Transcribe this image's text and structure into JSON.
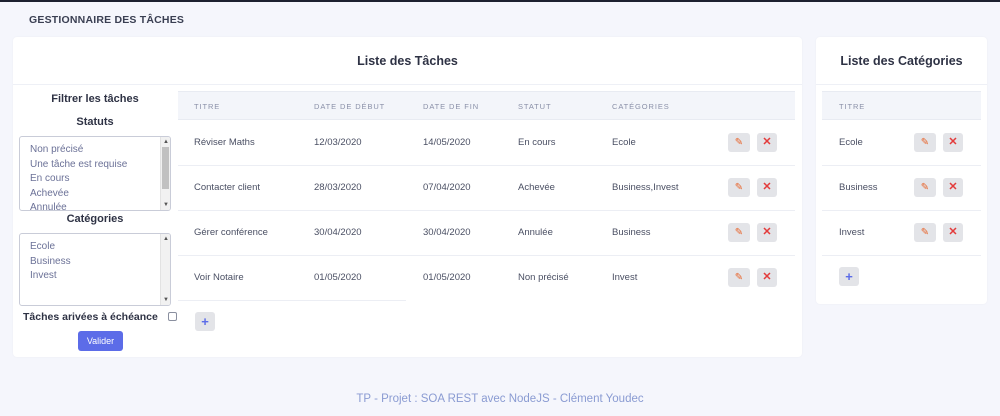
{
  "app": {
    "title": "GESTIONNAIRE DES TÂCHES"
  },
  "tasks": {
    "title": "Liste des Tâches",
    "columns": [
      "TITRE",
      "DATE DE DÉBUT",
      "DATE DE FIN",
      "STATUT",
      "CATÉGORIES"
    ],
    "rows": [
      [
        "Réviser Maths",
        "12/03/2020",
        "14/05/2020",
        "En cours",
        "Ecole"
      ],
      [
        "Contacter client",
        "28/03/2020",
        "07/04/2020",
        "Achevée",
        "Business,Invest"
      ],
      [
        "Gérer conférence",
        "30/04/2020",
        "30/04/2020",
        "Annulée",
        "Business"
      ],
      [
        "Voir Notaire",
        "01/05/2020",
        "01/05/2020",
        "Non précisé",
        "Invest"
      ]
    ],
    "add_icon": "+",
    "edit_icon": "✎",
    "delete_icon": "✕"
  },
  "filter": {
    "title": "Filtrer les tâches",
    "statuts_label": "Statuts",
    "statuts": [
      "Non précisé",
      "Une tâche est requise",
      "En cours",
      "Achevée",
      "Annulée"
    ],
    "categories_label": "Catégories",
    "categories": [
      "Ecole",
      "Business",
      "Invest"
    ],
    "echeance_label": "Tâches arivées à échéance",
    "submit": "Valider"
  },
  "categories": {
    "title": "Liste des Catégories",
    "column": "TITRE",
    "rows": [
      "Ecole",
      "Business",
      "Invest"
    ],
    "add_icon": "+"
  },
  "footer": {
    "text": "TP - Projet : SOA REST avec NodeJS - Clément Youdec"
  },
  "colors": {
    "accent": "#5c6ce8",
    "edit": "#e8642b",
    "delete": "#e33b3b",
    "background": "#f5f6fc"
  }
}
